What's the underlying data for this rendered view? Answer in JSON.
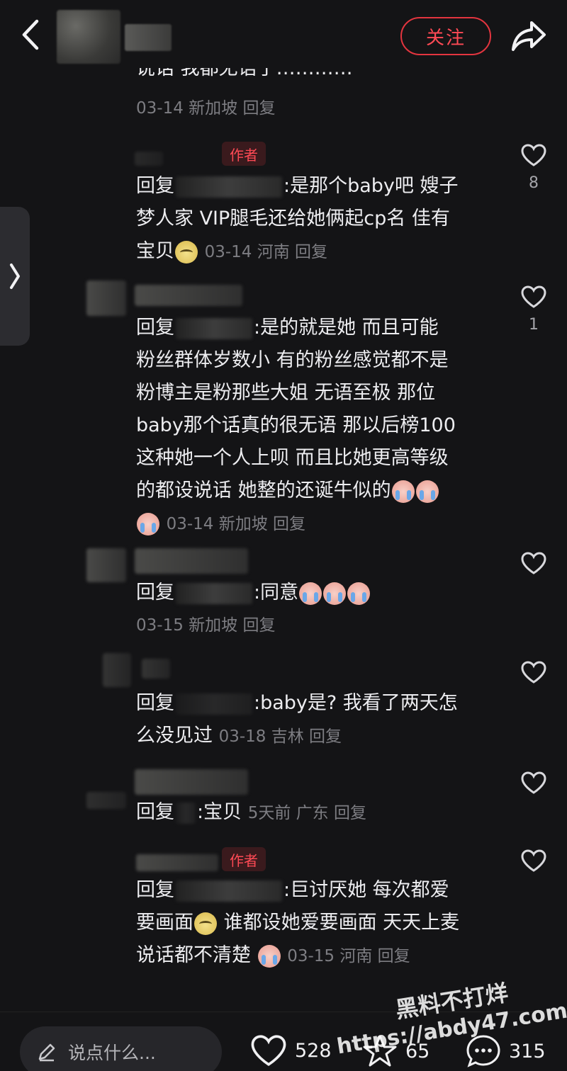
{
  "header": {
    "follow_label": "关注"
  },
  "comments": [
    {
      "partial_text": "说话 我都无语了…………",
      "meta": "03-14 新加坡 回复"
    },
    {
      "badge": "作者",
      "reply_prefix": "回复",
      "text1": ":是那个baby吧 嫂子",
      "text2": "梦人家 VIP腿毛还给她俩起cp名 佳有",
      "text3": "宝贝",
      "meta": "03-14 河南 回复",
      "like_count": "8"
    },
    {
      "reply_prefix": "回复",
      "text1": ":是的就是她 而且可能",
      "text2": "粉丝群体岁数小 有的粉丝感觉都不是",
      "text3": "粉博主是粉那些大姐 无语至极 那位",
      "text4": "baby那个话真的很无语 那以后榜100",
      "text5": "这种她一个人上呗 而且比她更高等级",
      "text6": "的都设说话 她整的还诞牛似的",
      "meta": "03-14 新加坡 回复",
      "like_count": "1"
    },
    {
      "reply_prefix": "回复",
      "text1": ":同意",
      "meta": "03-15 新加坡 回复"
    },
    {
      "reply_prefix": "回复",
      "text1": ":baby是? 我看了两天怎",
      "text2": "么没见过",
      "meta": "03-18 吉林 回复"
    },
    {
      "reply_prefix": "回复",
      "text1": ":宝贝",
      "meta": "5天前 广东 回复"
    },
    {
      "badge": "作者",
      "reply_prefix": "回复",
      "text1": ":巨讨厌她 每次都爱",
      "text2a": "要画面",
      "text2b": "谁都设她爱要画面 天天上麦",
      "text3": "说话都不清楚",
      "meta": "03-15 河南 回复"
    }
  ],
  "bottom": {
    "input_placeholder": "说点什么...",
    "likes": "528",
    "stars": "65",
    "comments": "315"
  },
  "watermark": {
    "line1": "黑料不打烊",
    "line2": "https://abdy47.com"
  },
  "colors": {
    "background": "#141416",
    "accent_red": "#ff4a55",
    "meta_gray": "#7d7d82"
  },
  "icons": [
    "back-icon",
    "share-icon",
    "chevron-right-icon",
    "heart-icon",
    "pen-icon",
    "star-icon",
    "comment-bubble-icon"
  ]
}
